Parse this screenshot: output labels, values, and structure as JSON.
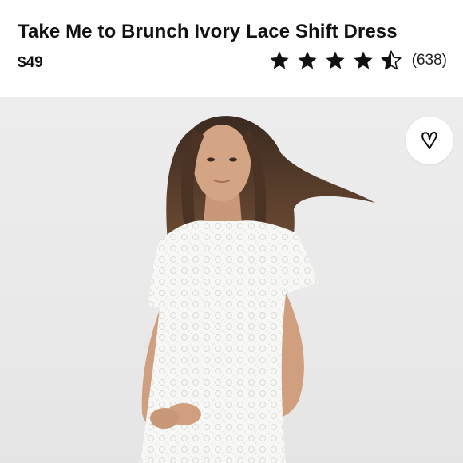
{
  "product": {
    "title": "Take Me to Brunch Ivory Lace Shift Dress",
    "price": "$49",
    "rating": 4.5,
    "rating_max": 5,
    "review_count": "(638)"
  },
  "icons": {
    "star_filled": "star-filled-icon",
    "star_half": "star-half-icon",
    "favorite": "heart-outline-icon"
  },
  "colors": {
    "text": "#111111",
    "photo_background": "#ebebeb",
    "dress": "#f7f7f5"
  }
}
